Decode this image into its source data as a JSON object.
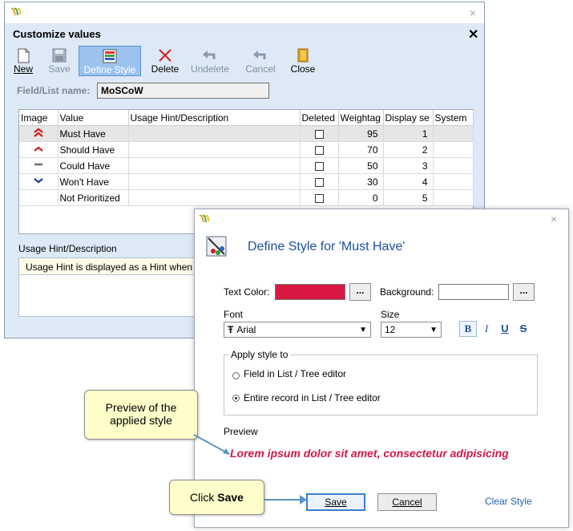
{
  "main_window": {
    "heading": "Customize values",
    "close_glyph": "×",
    "heading_close_glyph": "✕",
    "toolbar": [
      {
        "label": "New",
        "icon": "new-document-icon",
        "state": "normal"
      },
      {
        "label": "Save",
        "icon": "save-icon",
        "state": "disabled"
      },
      {
        "label": "Define Style",
        "icon": "define-style-icon",
        "state": "active"
      },
      {
        "label": "Delete",
        "icon": "delete-icon",
        "state": "normal"
      },
      {
        "label": "Undelete",
        "icon": "undo-icon",
        "state": "disabled"
      },
      {
        "label": "Cancel",
        "icon": "undo-icon",
        "state": "disabled"
      },
      {
        "label": "Close",
        "icon": "close-door-icon",
        "state": "normal"
      }
    ],
    "field_list_label": "Field/List name:",
    "field_list_value": "MoSCoW",
    "grid": {
      "columns": [
        "Image",
        "Value",
        "Usage Hint/Description",
        "Deleted",
        "Weightag",
        "Display se",
        "System"
      ],
      "rows": [
        {
          "icon": "double-chevron-up-icon",
          "value": "Must Have",
          "hint": "",
          "deleted": false,
          "weight": "95",
          "display": "1",
          "system": ""
        },
        {
          "icon": "chevron-up-icon",
          "value": "Should Have",
          "hint": "",
          "deleted": false,
          "weight": "70",
          "display": "2",
          "system": ""
        },
        {
          "icon": "dash-icon",
          "value": "Could Have",
          "hint": "",
          "deleted": false,
          "weight": "50",
          "display": "3",
          "system": ""
        },
        {
          "icon": "chevron-down-icon",
          "value": "Won't Have",
          "hint": "",
          "deleted": false,
          "weight": "30",
          "display": "4",
          "system": ""
        },
        {
          "icon": "",
          "value": "Not Prioritized",
          "hint": "",
          "deleted": false,
          "weight": "0",
          "display": "5",
          "system": ""
        }
      ]
    },
    "usage_hint_label": "Usage Hint/Description",
    "usage_hint_text": "Usage Hint is displayed as a Hint when"
  },
  "style_dialog": {
    "close_glyph": "×",
    "title": "Define Style for 'Must Have'",
    "text_color_label": "Text Color:",
    "background_label": "Background:",
    "dots_label": "...",
    "font_label": "Font",
    "font_value": "Arial",
    "font_type_glyph": "Ŧ",
    "size_label": "Size",
    "size_value": "12",
    "format_buttons": [
      "B",
      "I",
      "U",
      "S"
    ],
    "apply_label": "Apply style to",
    "apply_options": [
      "Field in List / Tree editor",
      "Entire record in List / Tree editor"
    ],
    "apply_selected": 1,
    "preview_label": "Preview",
    "preview_text": "Lorem ipsum dolor sit amet, consectetur adipisicing",
    "save_label": "Save",
    "cancel_label": "Cancel",
    "clear_label": "Clear Style",
    "colors": {
      "text": "#d81842",
      "background": "#ffffff",
      "title": "#1f4fa0"
    }
  },
  "callouts": {
    "preview": "Preview of the applied style",
    "click_prefix": "Click ",
    "click_bold": "Save"
  },
  "colors": {
    "accent": "#3c7fd0",
    "window_bg": "#dde9f6",
    "callout_bg": "#fefecb"
  }
}
